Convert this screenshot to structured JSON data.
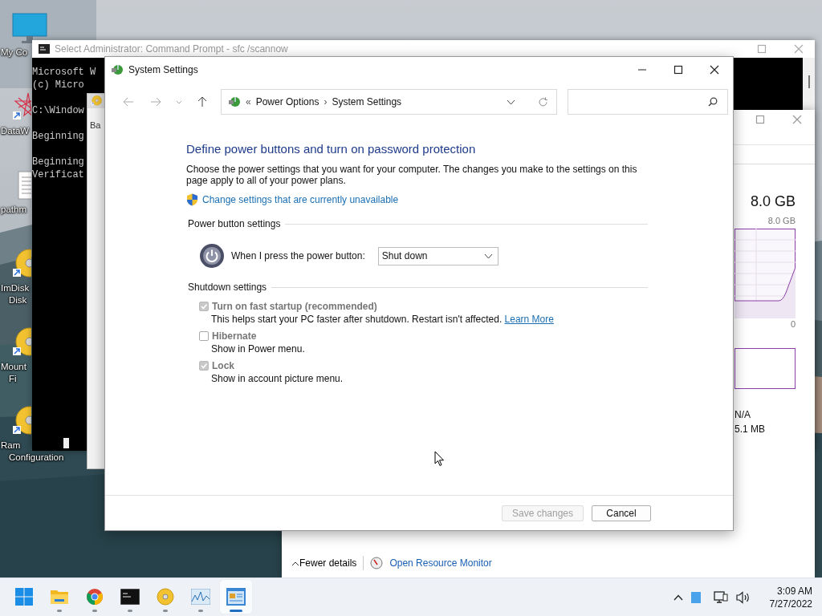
{
  "desktop": {
    "icons": [
      {
        "kind": "monitor",
        "label_lines": [
          "My Co"
        ]
      },
      {
        "kind": "star",
        "label_lines": [
          "DataW"
        ]
      },
      {
        "kind": "document",
        "label_lines": [
          "pathm"
        ]
      },
      {
        "kind": "disc",
        "label_lines": [
          "ImDisk",
          "Disk"
        ]
      },
      {
        "kind": "disc",
        "label_lines": [
          "Mount",
          "Fi"
        ]
      },
      {
        "kind": "disc",
        "label_lines": [
          "Ram",
          "Configuration"
        ]
      }
    ]
  },
  "command_prompt": {
    "title": "Select Administrator: Command Prompt - sfc /scannow",
    "paragraphs": [
      [
        "Microsoft W",
        "(c) Micro"
      ],
      [
        "C:\\Window"
      ],
      [
        "Beginning"
      ],
      [
        "Beginning",
        "Verificat"
      ]
    ]
  },
  "disk_window": {
    "tab": "Ba"
  },
  "task_manager": {
    "memory_total": "8.0 GB",
    "graph_max": "8.0 GB",
    "graph_min": "0",
    "stat_1": "N/A",
    "stat_2": "5.1 MB",
    "fewer_details": "Fewer details",
    "resource_monitor_link": "Open Resource Monitor"
  },
  "dialog": {
    "title": "System Settings",
    "address": {
      "prefix": "«",
      "separator": "›",
      "crumbs": [
        "Power Options",
        "System Settings"
      ]
    },
    "heading": "Define power buttons and turn on password protection",
    "description": "Choose the power settings that you want for your computer. The changes you make to the settings on this page apply to all of your power plans.",
    "admin_link": "Change settings that are currently unavailable",
    "power_button_settings": {
      "title": "Power button settings",
      "label": "When I press the power button:",
      "value": "Shut down"
    },
    "shutdown_settings": {
      "title": "Shutdown settings",
      "items": [
        {
          "label": "Turn on fast startup (recommended)",
          "description": "This helps start your PC faster after shutdown. Restart isn't affected.",
          "link": "Learn More",
          "checked": true,
          "disabled": true
        },
        {
          "label": "Hibernate",
          "description": "Show in Power menu.",
          "checked": false,
          "disabled": true
        },
        {
          "label": "Lock",
          "description": "Show in account picture menu.",
          "checked": true,
          "disabled": true
        }
      ]
    },
    "buttons": [
      {
        "label": "Save changes",
        "disabled": true
      },
      {
        "label": "Cancel",
        "disabled": false
      }
    ]
  },
  "taskbar": {
    "apps": [
      {
        "kind": "start",
        "running": false,
        "selected": false
      },
      {
        "kind": "folder",
        "running": true,
        "selected": false
      },
      {
        "kind": "browser",
        "running": true,
        "selected": false
      },
      {
        "kind": "terminal",
        "running": true,
        "selected": false
      },
      {
        "kind": "disc",
        "running": true,
        "selected": false
      },
      {
        "kind": "chart",
        "running": true,
        "selected": false
      },
      {
        "kind": "window",
        "running": true,
        "selected": true
      }
    ],
    "time": "3:09 AM",
    "date": "7/27/2022"
  }
}
